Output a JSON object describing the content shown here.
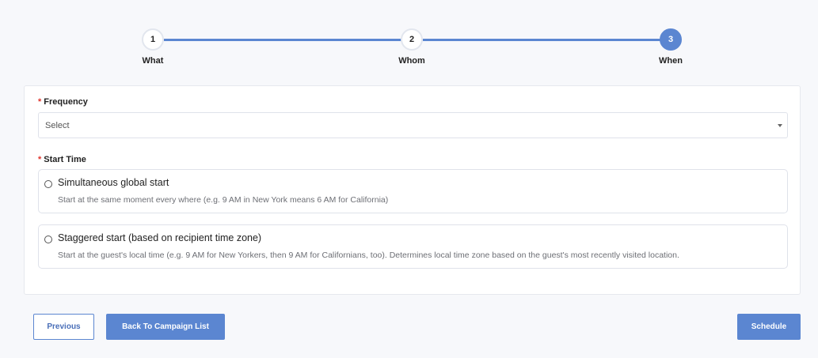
{
  "stepper": {
    "steps": [
      {
        "number": "1",
        "label": "What",
        "active": false
      },
      {
        "number": "2",
        "label": "Whom",
        "active": false
      },
      {
        "number": "3",
        "label": "When",
        "active": true
      }
    ]
  },
  "form": {
    "frequency": {
      "required_marker": "*",
      "label": "Frequency",
      "value": "Select"
    },
    "start_time": {
      "required_marker": "*",
      "label": "Start Time",
      "options": [
        {
          "title": "Simultaneous global start",
          "description": "Start at the same moment every where (e.g. 9 AM in New York means 6 AM for California)",
          "selected": false
        },
        {
          "title": "Staggered start (based on recipient time zone)",
          "description": "Start at the guest's local time (e.g. 9 AM for New Yorkers, then 9 AM for Californians, too). Determines local time zone based on the guest's most recently visited location.",
          "selected": false
        }
      ]
    }
  },
  "actions": {
    "previous_label": "Previous",
    "back_label": "Back To Campaign List",
    "schedule_label": "Schedule"
  },
  "colors": {
    "accent": "#5b86d1",
    "required": "#e0342c",
    "background": "#f7f8fb"
  }
}
